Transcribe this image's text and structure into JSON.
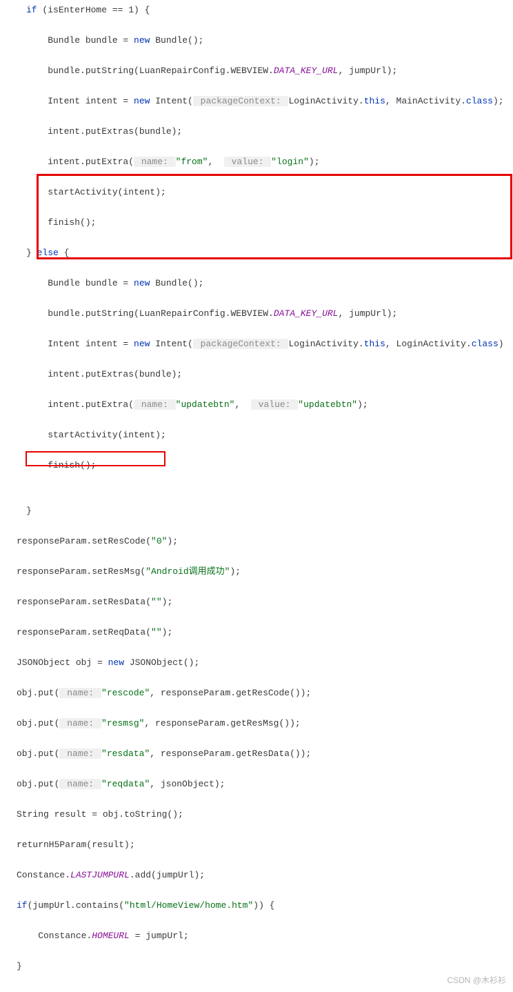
{
  "code": {
    "l01a": "if",
    "l01b": " (isEnterHome == ",
    "l01c": "1",
    "l01d": ") {",
    "l02a": "    Bundle bundle = ",
    "l02b": "new",
    "l02c": " Bundle();",
    "l03a": "    bundle.putString(LuanRepairConfig.WEBVIEW.",
    "l03b": "DATA_KEY_URL",
    "l03c": ", jumpUrl);",
    "l04a": "    Intent intent = ",
    "l04b": "new",
    "l04c": " Intent(",
    "l04d": " packageContext: ",
    "l04e": "LoginActivity.",
    "l04f": "this",
    "l04g": ", MainActivity.",
    "l04h": "class",
    "l04i": ");",
    "l05a": "    intent.putExtras(bundle);",
    "l06a": "    intent.putExtra(",
    "l06b": " name: ",
    "l06c": "\"from\"",
    "l06d": ",  ",
    "l06e": " value: ",
    "l06f": "\"login\"",
    "l06g": ");",
    "l07a": "    startActivity(intent);",
    "l08a": "    finish();",
    "l09a": "} ",
    "l09b": "else",
    "l09c": " {",
    "l10a": "    Bundle bundle = ",
    "l10b": "new",
    "l10c": " Bundle();",
    "l11a": "    bundle.putString(LuanRepairConfig.WEBVIEW.",
    "l11b": "DATA_KEY_URL",
    "l11c": ", jumpUrl);",
    "l12a": "    Intent intent = ",
    "l12b": "new",
    "l12c": " Intent(",
    "l12d": " packageContext: ",
    "l12e": "LoginActivity.",
    "l12f": "this",
    "l12g": ", LoginActivity.",
    "l12h": "class",
    "l12i": ")",
    "l13a": "    intent.putExtras(bundle);",
    "l14a": "    intent.putExtra(",
    "l14b": " name: ",
    "l14c": "\"updatebtn\"",
    "l14d": ",  ",
    "l14e": " value: ",
    "l14f": "\"updatebtn\"",
    "l14g": ");",
    "l15a": "    startActivity(intent);",
    "l16a": "    finish();",
    "l18a": "}",
    "l19a": "responseParam.setResCode(",
    "l19b": "\"0\"",
    "l19c": ");",
    "l20a": "responseParam.setResMsg(",
    "l20b": "\"Android调用成功\"",
    "l20c": ");",
    "l21a": "responseParam.setResData(",
    "l21b": "\"\"",
    "l21c": ");",
    "l22a": "responseParam.setReqData(",
    "l22b": "\"\"",
    "l22c": ");",
    "l23a": "JSONObject obj = ",
    "l23b": "new",
    "l23c": " JSONObject();",
    "l24a": "obj.put(",
    "l24b": " name: ",
    "l24c": "\"rescode\"",
    "l24d": ", responseParam.getResCode());",
    "l25a": "obj.put(",
    "l25b": " name: ",
    "l25c": "\"resmsg\"",
    "l25d": ", responseParam.getResMsg());",
    "l26a": "obj.put(",
    "l26b": " name: ",
    "l26c": "\"resdata\"",
    "l26d": ", responseParam.getResData());",
    "l27a": "obj.put(",
    "l27b": " name: ",
    "l27c": "\"reqdata\"",
    "l27d": ", jsonObject);",
    "l28a": "String result = obj.toString();",
    "l29a": "returnH5Param(result);",
    "l30a": "Constance.",
    "l30b": "LASTJUMPURL",
    "l30c": ".add(jumpUrl);",
    "l31a": "if",
    "l31b": "(jumpUrl.contains(",
    "l31c": "\"html/HomeView/home.htm\"",
    "l31d": ")) {",
    "l32a": "    Constance.",
    "l32b": "HOMEURL",
    "l32c": " = jumpUrl;",
    "l33a": "}"
  },
  "watermark": "CSDN @木衫衫"
}
